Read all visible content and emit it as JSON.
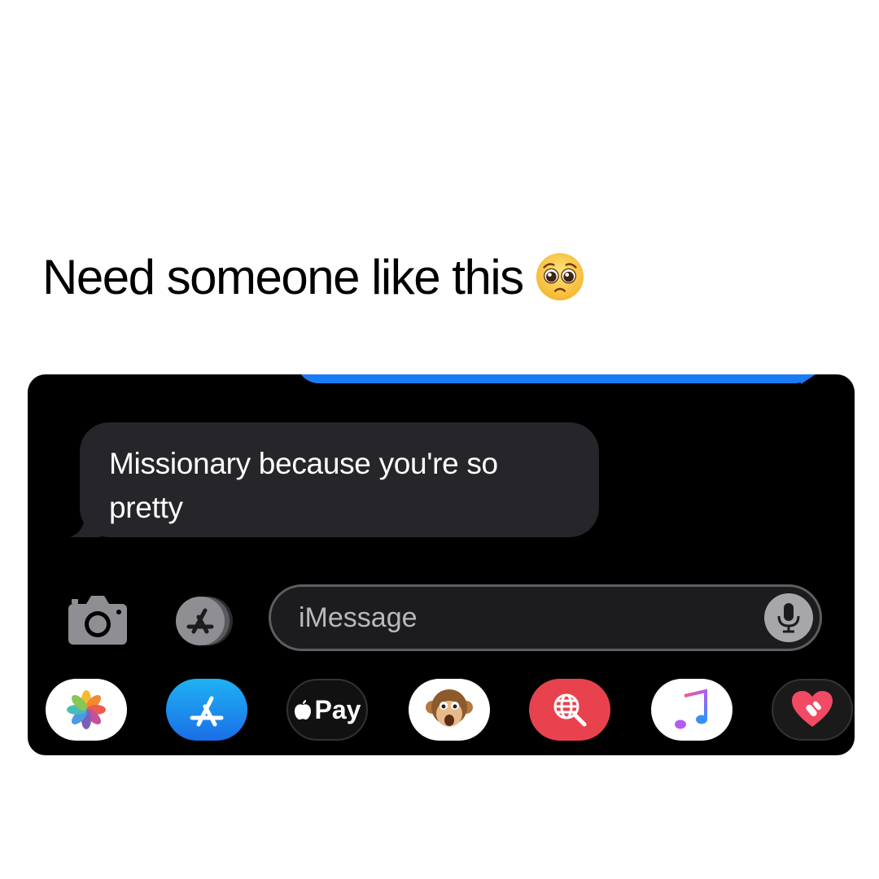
{
  "caption": {
    "text": "Need someone like this",
    "emoji": "pleading-face-emoji"
  },
  "conversation": {
    "received_message": "Missionary because you're so pretty",
    "sent_bubble_color": "#1a7cf5",
    "received_bubble_color": "#262529"
  },
  "composer": {
    "placeholder": "iMessage",
    "camera_icon": "camera-icon",
    "apps_icon": "app-store-icon",
    "mic_icon": "microphone-icon"
  },
  "app_drawer": {
    "apps": [
      {
        "name": "photos",
        "icon": "photos-icon"
      },
      {
        "name": "app-store",
        "icon": "app-store-icon"
      },
      {
        "name": "apple-pay",
        "icon": "apple-icon",
        "label": "Pay"
      },
      {
        "name": "animoji",
        "icon": "monkey-animoji-icon"
      },
      {
        "name": "image-search",
        "icon": "globe-search-icon"
      },
      {
        "name": "music",
        "icon": "music-note-icon"
      },
      {
        "name": "digital-touch",
        "icon": "heart-touch-icon"
      }
    ]
  }
}
